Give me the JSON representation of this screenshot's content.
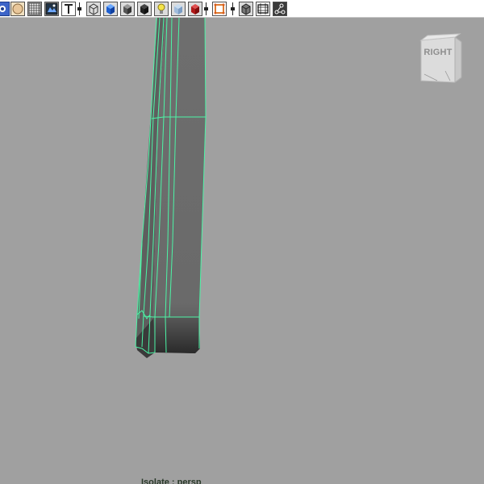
{
  "toolbar": {
    "buttons": [
      {
        "name": "select-camera-icon"
      },
      {
        "name": "shaded-sphere-icon"
      },
      {
        "name": "grid-icon"
      },
      {
        "name": "image-plane-icon"
      },
      {
        "name": "textured-icon"
      },
      {
        "name": "wireframe-cube-icon"
      },
      {
        "name": "smooth-shade-cube-icon"
      },
      {
        "name": "default-material-cube-icon"
      },
      {
        "name": "shadows-icon"
      },
      {
        "name": "lights-icon"
      },
      {
        "name": "xray-icon"
      },
      {
        "name": "xray-joints-icon"
      },
      {
        "name": "isolate-select-icon"
      },
      {
        "name": "xray-active-icon"
      },
      {
        "name": "resolution-gate-icon"
      },
      {
        "name": "safe-title-icon"
      }
    ]
  },
  "viewport": {
    "viewcube_label": "RIGHT",
    "hud_text": "Isolate : persp",
    "background_color": "#a0a0a0",
    "wire_color": "#4cf5a6",
    "mesh_color": "#6b6b6b"
  }
}
